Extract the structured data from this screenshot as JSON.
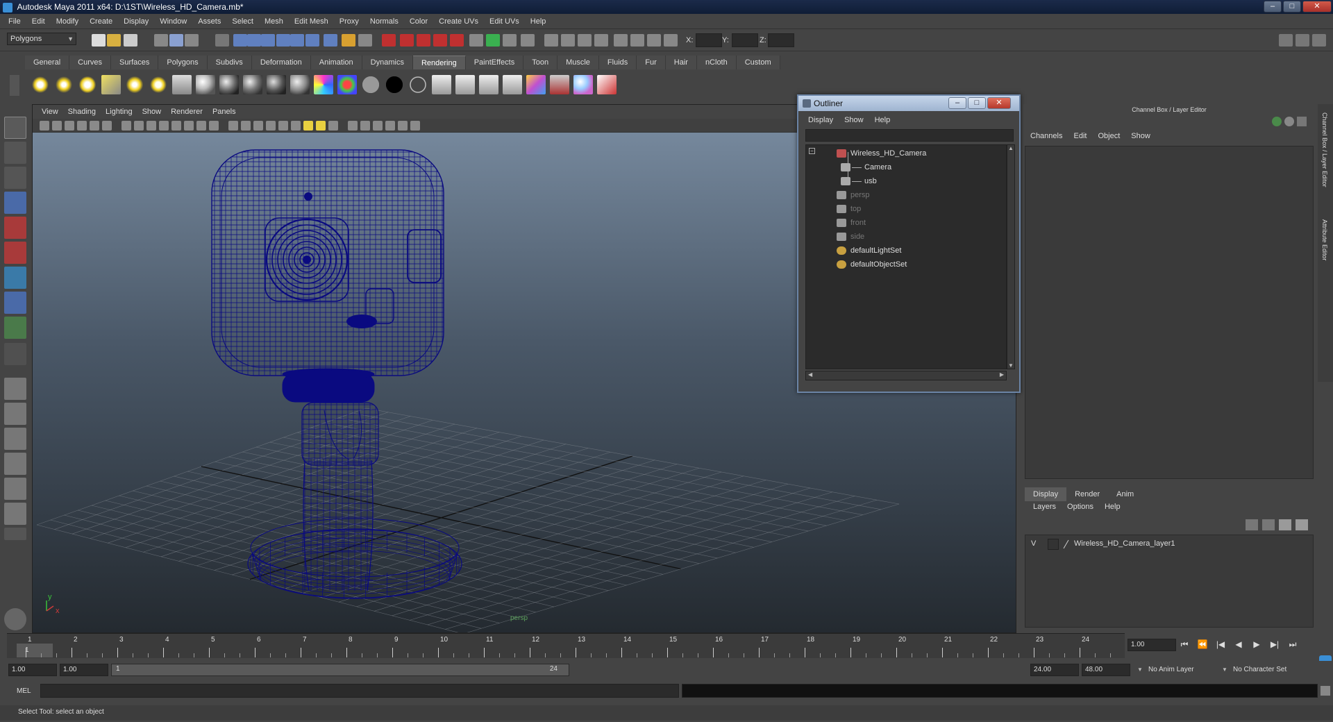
{
  "window": {
    "title": "Autodesk Maya 2011 x64: D:\\1ST\\Wireless_HD_Camera.mb*"
  },
  "menubar": [
    "File",
    "Edit",
    "Modify",
    "Create",
    "Display",
    "Window",
    "Assets",
    "Select",
    "Mesh",
    "Edit Mesh",
    "Proxy",
    "Normals",
    "Color",
    "Create UVs",
    "Edit UVs",
    "Help"
  ],
  "statusline": {
    "mode": "Polygons",
    "x_label": "X:",
    "y_label": "Y:",
    "z_label": "Z:"
  },
  "shelf": {
    "tabs": [
      "General",
      "Curves",
      "Surfaces",
      "Polygons",
      "Subdivs",
      "Deformation",
      "Animation",
      "Dynamics",
      "Rendering",
      "PaintEffects",
      "Toon",
      "Muscle",
      "Fluids",
      "Fur",
      "Hair",
      "nCloth",
      "Custom"
    ],
    "active_tab": "Rendering"
  },
  "viewport": {
    "menu": [
      "View",
      "Shading",
      "Lighting",
      "Show",
      "Renderer",
      "Panels"
    ],
    "camera_label": "persp",
    "axis_x": "x",
    "axis_y": "y",
    "wire_color": "#0a0a80"
  },
  "outliner": {
    "title": "Outliner",
    "menu": [
      "Display",
      "Show",
      "Help"
    ],
    "items": [
      {
        "label": "Wireless_HD_Camera",
        "indent": 0,
        "dim": false,
        "icon": "transform-icon"
      },
      {
        "label": "Camera",
        "indent": 1,
        "dim": false,
        "icon": "mesh-icon"
      },
      {
        "label": "usb",
        "indent": 1,
        "dim": false,
        "icon": "mesh-icon"
      },
      {
        "label": "persp",
        "indent": 0,
        "dim": true,
        "icon": "camera-icon"
      },
      {
        "label": "top",
        "indent": 0,
        "dim": true,
        "icon": "camera-icon"
      },
      {
        "label": "front",
        "indent": 0,
        "dim": true,
        "icon": "camera-icon"
      },
      {
        "label": "side",
        "indent": 0,
        "dim": true,
        "icon": "camera-icon"
      },
      {
        "label": "defaultLightSet",
        "indent": 0,
        "dim": false,
        "icon": "set-icon"
      },
      {
        "label": "defaultObjectSet",
        "indent": 0,
        "dim": false,
        "icon": "set-icon"
      }
    ]
  },
  "channelbox": {
    "title": "Channel Box / Layer Editor",
    "menu": [
      "Channels",
      "Edit",
      "Object",
      "Show"
    ],
    "side_tabs": [
      "Channel Box / Layer Editor",
      "Attribute Editor"
    ]
  },
  "layer_editor": {
    "tabs": [
      "Display",
      "Render",
      "Anim"
    ],
    "active_tab": "Display",
    "menu": [
      "Layers",
      "Options",
      "Help"
    ],
    "layer": {
      "visibility": "V",
      "name": "Wireless_HD_Camera_layer1"
    }
  },
  "timeslider": {
    "ticks": [
      "1",
      "2",
      "3",
      "4",
      "5",
      "6",
      "7",
      "8",
      "9",
      "10",
      "11",
      "12",
      "13",
      "14",
      "15",
      "16",
      "17",
      "18",
      "19",
      "20",
      "21",
      "22",
      "23",
      "24"
    ],
    "current_frame_marker": "1",
    "current_frame": "1.00"
  },
  "playback": [
    "⏮",
    "⏪",
    "|◀",
    "◀",
    "▶",
    "▶|",
    "⏭"
  ],
  "range": {
    "start_time": "1.00",
    "playback_start": "1.00",
    "range_start_label": "1",
    "range_end_label": "24",
    "playback_end": "24.00",
    "end_time": "48.00",
    "anim_layer": "No Anim Layer",
    "character_set": "No Character Set"
  },
  "cmdline": {
    "label": "MEL"
  },
  "helpline": {
    "text": "Select Tool: select an object"
  }
}
